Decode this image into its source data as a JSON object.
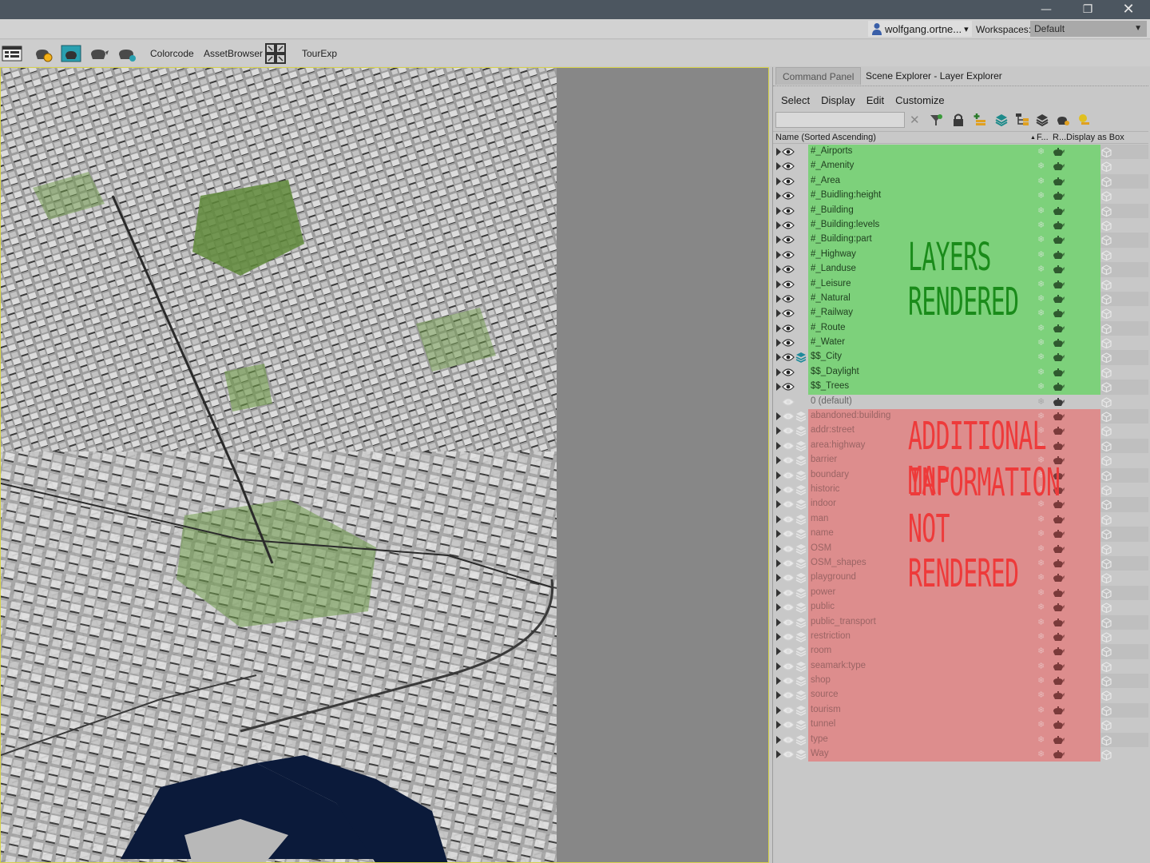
{
  "window": {
    "minimize_glyph": "—",
    "maximize_glyph": "❐",
    "close_glyph": "✕"
  },
  "account": {
    "user": "wolfgang.ortne...",
    "user_arrow": "▾",
    "workspaces_label": "Workspaces:",
    "workspace_value": "Default",
    "workspace_arrow": "▼"
  },
  "toolbar": {
    "colorcode": "Colorcode",
    "asset_browser": "AssetBrowser",
    "tour_exp": "TourExp"
  },
  "panel": {
    "tabs": [
      "Command Panel",
      "Scene Explorer - Layer Explorer"
    ],
    "menu": [
      "Select",
      "Display",
      "Edit",
      "Customize"
    ],
    "search_value": "",
    "clear_glyph": "✕",
    "columns": {
      "name": "Name (Sorted Ascending)",
      "sort_arrow": "▲",
      "freeze": "F...",
      "render": "R...",
      "display_box": "Display as Box"
    }
  },
  "layers_rendered": [
    "#_Airports",
    "#_Amenity",
    "#_Area",
    "#_Buidling:height",
    "#_Building",
    "#_Building:levels",
    "#_Building:part",
    "#_Highway",
    "#_Landuse",
    "#_Leisure",
    "#_Natural",
    "#_Railway",
    "#_Route",
    "#_Water",
    "$$_City",
    "$$_Daylight",
    "$$_Trees"
  ],
  "layer_default": "0 (default)",
  "layers_not_rendered": [
    "abandoned:building",
    "addr:street",
    "area:highway",
    "barrier",
    "boundary",
    "historic",
    "indoor",
    "man",
    "name",
    "OSM",
    "OSM_shapes",
    "playground",
    "power",
    "public",
    "public_transport",
    "restriction",
    "room",
    "seamark:type",
    "shop",
    "source",
    "tourism",
    "tunnel",
    "type",
    "Way"
  ],
  "annotations": {
    "rendered": "LAYERS RENDERED",
    "not_rendered_1": "ADDITIONAL MAP",
    "not_rendered_2": "INFORMATION",
    "not_rendered_3": "NOT RENDERED"
  },
  "colors": {
    "rendered_bg": "#7dd17b",
    "not_rendered_bg": "#dd8d8d",
    "annot_green": "#1a8b1a",
    "annot_red": "#ee3a3a",
    "viewport_border": "#d7d24a",
    "water": "#0b1a3a"
  },
  "icons": {
    "row_eye": "eye-icon",
    "row_freeze": "snowflake-icon",
    "row_render": "teapot-icon",
    "row_box": "box-icon",
    "city_layer": "layer-stack-icon"
  }
}
